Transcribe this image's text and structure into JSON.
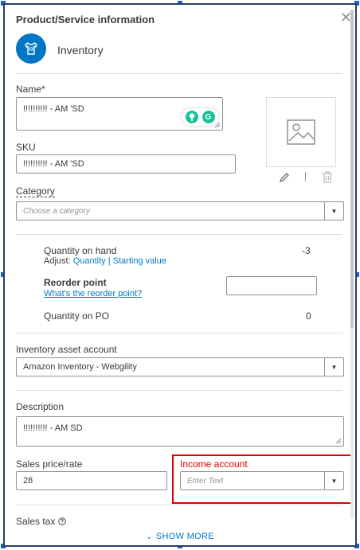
{
  "dialog": {
    "title": "Product/Service information",
    "close_glyph": "✕",
    "type_label": "Inventory"
  },
  "name": {
    "label": "Name*",
    "value": "!!!!!!!!!! - AM 'SD"
  },
  "sku": {
    "label": "SKU",
    "value": "!!!!!!!!!! - AM 'SD"
  },
  "category": {
    "label": "Category",
    "placeholder": "Choose a category"
  },
  "quantity": {
    "on_hand_label": "Quantity on hand",
    "on_hand_value": "-3",
    "adjust_prefix": "Adjust:",
    "adjust_quantity": "Quantity",
    "separator": "|",
    "adjust_starting": "Starting value",
    "reorder_label": "Reorder point",
    "reorder_link": "What's the reorder point?",
    "on_po_label": "Quantity on PO",
    "on_po_value": "0"
  },
  "inventory_asset": {
    "label": "Inventory asset account",
    "value": "Amazon Inventory - Webgility"
  },
  "description": {
    "label": "Description",
    "value": "!!!!!!!!!! - AM SD"
  },
  "sales_price": {
    "label": "Sales price/rate",
    "value": "28"
  },
  "income_account": {
    "label": "Income account",
    "placeholder": "Enter Text"
  },
  "sales_tax": {
    "label": "Sales tax"
  },
  "footer": {
    "show_more": "SHOW MORE"
  },
  "colors": {
    "accent": "#0077c5",
    "highlight": "#e10000",
    "border": "#2a3d66"
  }
}
